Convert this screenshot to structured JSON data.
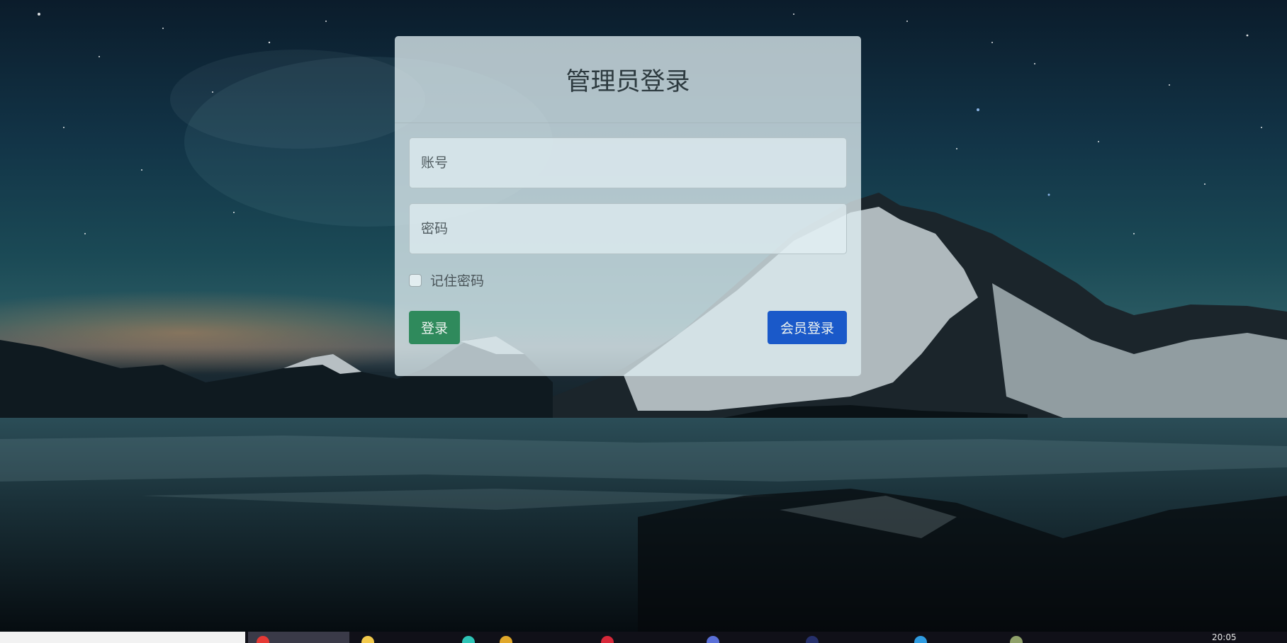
{
  "login_panel": {
    "title": "管理员登录",
    "account_placeholder": "账号",
    "password_placeholder": "密码",
    "remember_label": "记住密码",
    "login_button": "登录",
    "member_login_button": "会员登录"
  },
  "taskbar": {
    "time": "20:05"
  },
  "colors": {
    "login_button": "#2f8a5c",
    "member_button": "#1a59c9"
  }
}
